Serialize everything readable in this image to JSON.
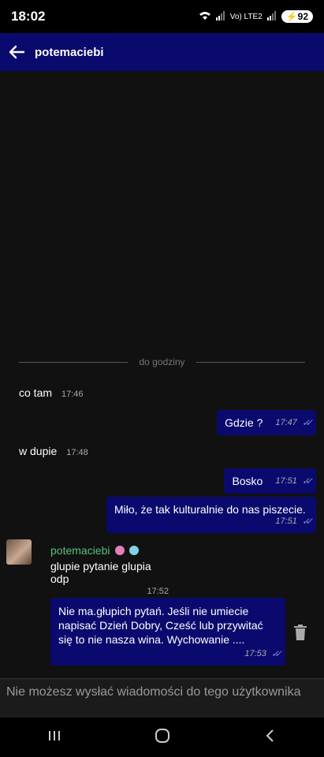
{
  "status": {
    "time": "18:02",
    "network": "Vo) LTE2",
    "battery": "92"
  },
  "header": {
    "title": "potemaciebi"
  },
  "chat": {
    "divider": "do godziny",
    "messages": [
      {
        "dir": "in",
        "text": "co tam",
        "time": "17:46"
      },
      {
        "dir": "out",
        "text": "Gdzie ?",
        "time": "17:47"
      },
      {
        "dir": "in",
        "text": "w dupie",
        "time": "17:48"
      },
      {
        "dir": "out",
        "text": "Bosko",
        "time": "17:51"
      },
      {
        "dir": "out",
        "text": "Miło, że tak kulturalnie do nas piszecie.",
        "time": "17:51"
      },
      {
        "dir": "in",
        "sender": "potemaciebi",
        "text": "glupie pytanie glupia odp",
        "time": "17:52"
      },
      {
        "dir": "out",
        "text": "Nie ma.głupich pytań. Jeśli nie umiecie napisać Dzień Dobry, Cześć lub przywitać się to nie nasza wina. Wychowanie ....",
        "time": "17:53"
      }
    ]
  },
  "composer": {
    "notice": "Nie możesz wysłać wiadomości do tego użytkownika"
  },
  "colors": {
    "accent": "#0a0a6e",
    "sender": "#58c27a"
  }
}
